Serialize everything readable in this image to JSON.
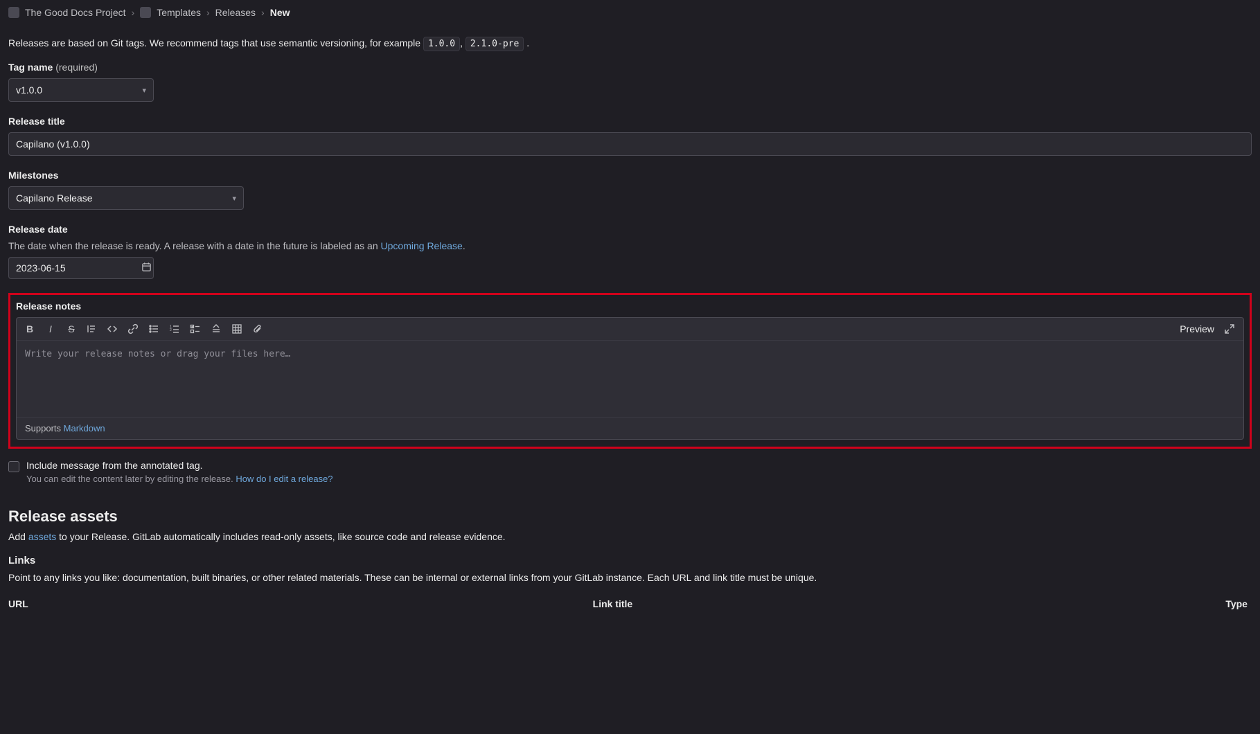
{
  "breadcrumb": {
    "project": "The Good Docs Project",
    "group": "Templates",
    "section": "Releases",
    "current": "New"
  },
  "intro": {
    "text_before": "Releases are based on Git tags. We recommend tags that use semantic versioning, for example ",
    "code1": "1.0.0",
    "sep": ", ",
    "code2": "2.1.0-pre",
    "text_after": " ."
  },
  "tag": {
    "label": "Tag name",
    "required": "(required)",
    "value": "v1.0.0"
  },
  "title": {
    "label": "Release title",
    "value": "Capilano (v1.0.0)"
  },
  "milestones": {
    "label": "Milestones",
    "value": "Capilano Release"
  },
  "date": {
    "label": "Release date",
    "helper_before": "The date when the release is ready. A release with a date in the future is labeled as an ",
    "helper_link": "Upcoming Release",
    "helper_after": ".",
    "value": "2023-06-15"
  },
  "notes": {
    "label": "Release notes",
    "placeholder": "Write your release notes or drag your files here…",
    "preview": "Preview",
    "supports": "Supports ",
    "markdown": "Markdown"
  },
  "include_tag": {
    "label": "Include message from the annotated tag.",
    "sub_before": "You can edit the content later by editing the release. ",
    "sub_link": "How do I edit a release?"
  },
  "assets": {
    "heading": "Release assets",
    "intro_before": "Add ",
    "intro_link": "assets",
    "intro_after": " to your Release. GitLab automatically includes read-only assets, like source code and release evidence."
  },
  "links": {
    "heading": "Links",
    "intro": "Point to any links you like: documentation, built binaries, or other related materials. These can be internal or external links from your GitLab instance. Each URL and link title must be unique.",
    "col_url": "URL",
    "col_title": "Link title",
    "col_type": "Type"
  }
}
